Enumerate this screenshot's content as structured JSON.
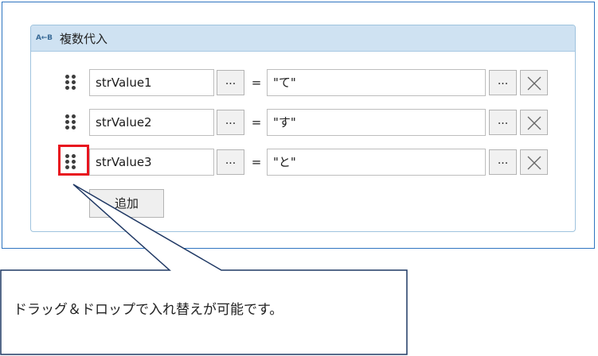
{
  "activity": {
    "icon_label": "A←B",
    "title": "複数代入"
  },
  "rows": [
    {
      "variable": "strValue1",
      "variable_browse": "...",
      "operator": "=",
      "value": "\"て\"",
      "value_browse": "..."
    },
    {
      "variable": "strValue2",
      "variable_browse": "...",
      "operator": "=",
      "value": "\"す\"",
      "value_browse": "..."
    },
    {
      "variable": "strValue3",
      "variable_browse": "...",
      "operator": "=",
      "value": "\"と\"",
      "value_browse": "..."
    }
  ],
  "add_button_label": "追加",
  "callout": {
    "text": "ドラッグ＆ドロップで入れ替えが可能です。",
    "highlight_color": "#e8141e",
    "border_color": "#1f3864"
  },
  "colors": {
    "frame_border": "#2e74c0",
    "header_bg": "#cfe2f2"
  }
}
